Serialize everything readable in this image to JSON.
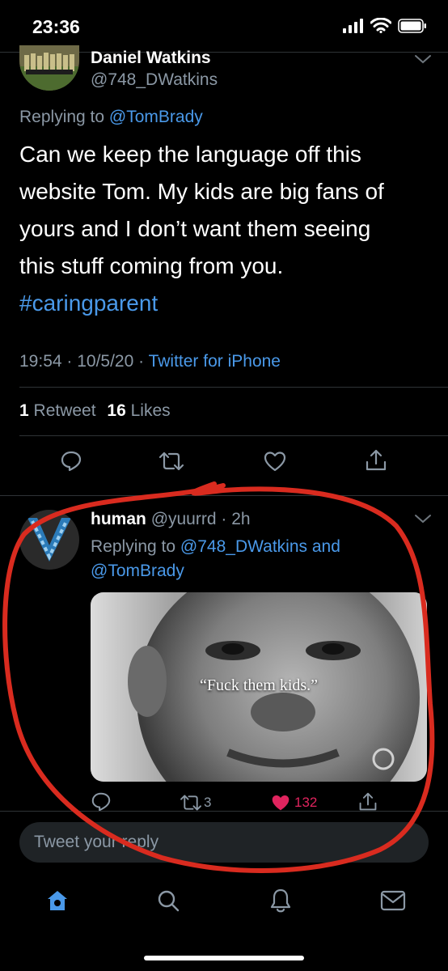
{
  "status_bar": {
    "time": "23:36"
  },
  "tweet": {
    "name": "Daniel Watkins",
    "handle": "@748_DWatkins",
    "replying_prefix": "Replying to",
    "replying_to": "@TomBrady",
    "body_lines": [
      "Can we keep the language off this",
      "website Tom. My kids are big fans of",
      "yours and I don’t want them seeing",
      "this stuff coming from you."
    ],
    "hashtag": "#caringparent",
    "timestamp": "19:54 · 10/5/20 ·",
    "source": "Twitter for iPhone",
    "retweets_count": "1",
    "retweets_label": "Retweet",
    "likes_count": "16",
    "likes_label": "Likes"
  },
  "reply": {
    "name": "human",
    "handle": "@yuurrd · 2h",
    "replying_prefix": "Replying to",
    "replying_to_1": "@748_DWatkins and",
    "replying_to_2": "@TomBrady",
    "image_caption": "“Fuck them kids.”",
    "retweet_count": "3",
    "like_count": "132"
  },
  "compose": {
    "placeholder": "Tweet your reply"
  },
  "colors": {
    "accent": "#4a99e9",
    "like": "#e0245e",
    "annotation": "#d92b1f"
  },
  "icons": [
    "chevron-down-icon",
    "reply-icon",
    "retweet-icon",
    "like-icon",
    "share-icon",
    "home-icon",
    "search-icon",
    "bell-icon",
    "mail-icon"
  ]
}
